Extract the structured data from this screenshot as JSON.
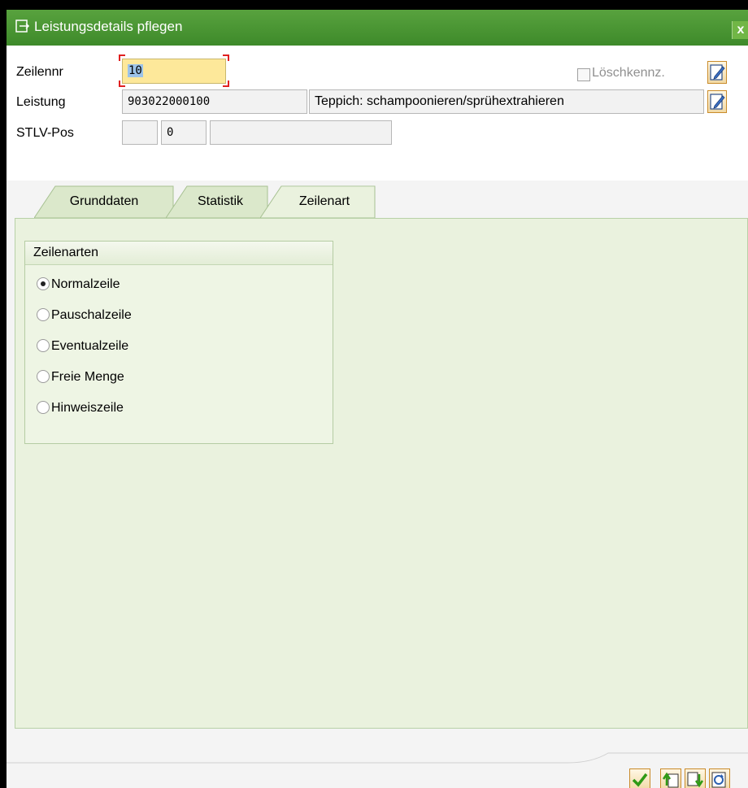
{
  "window": {
    "title": "Leistungsdetails pflegen",
    "close_label": "x"
  },
  "header": {
    "zeilennr": {
      "label": "Zeilennr",
      "value": "10"
    },
    "loeschkennz": {
      "label": "Löschkennz.",
      "checked": false
    },
    "leistung": {
      "label": "Leistung",
      "value": "903022000100",
      "description": "Teppich: schampoonieren/sprühextrahieren"
    },
    "stlv": {
      "label": "STLV-Pos",
      "value1": "",
      "value2": "0",
      "value3": ""
    }
  },
  "tabs": [
    {
      "label": "Grunddaten",
      "active": false
    },
    {
      "label": "Statistik",
      "active": false
    },
    {
      "label": "Zeilenart",
      "active": true
    }
  ],
  "group": {
    "title": "Zeilenarten",
    "options": [
      {
        "label": "Normalzeile",
        "selected": true
      },
      {
        "label": "Pauschalzeile",
        "selected": false
      },
      {
        "label": "Eventualzeile",
        "selected": false
      },
      {
        "label": "Freie Menge",
        "selected": false
      },
      {
        "label": "Hinweiszeile",
        "selected": false
      }
    ]
  },
  "footer_buttons": [
    "check-icon",
    "previous-entry-icon",
    "next-entry-icon",
    "refresh-icon"
  ],
  "colors": {
    "title_bar": "#4a9634",
    "panel": "#eaf2de",
    "active_field": "#fde89a"
  }
}
